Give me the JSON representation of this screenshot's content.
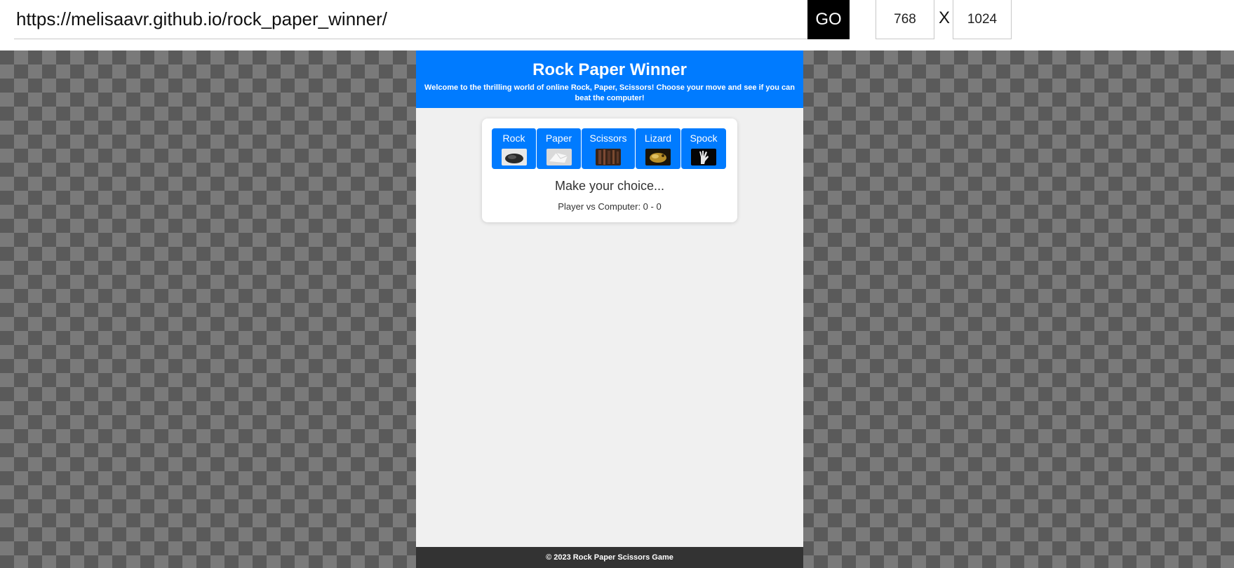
{
  "toolbar": {
    "url": "https://melisaavr.github.io/rock_paper_winner/",
    "go_label": "GO",
    "width_value": "768",
    "separator": "X",
    "height_value": "1024"
  },
  "header": {
    "title": "Rock Paper Winner",
    "subtitle": "Welcome to the thrilling world of online Rock, Paper, Scissors! Choose your move and see if you can beat the computer!"
  },
  "choices": [
    {
      "label": "Rock",
      "icon": "rock-photo"
    },
    {
      "label": "Paper",
      "icon": "paper-photo"
    },
    {
      "label": "Scissors",
      "icon": "scissors-photo"
    },
    {
      "label": "Lizard",
      "icon": "lizard-photo"
    },
    {
      "label": "Spock",
      "icon": "spock-hand-photo"
    }
  ],
  "game": {
    "result": "Make your choice...",
    "score": "Player vs Computer: 0 - 0"
  },
  "footer": {
    "text": "© 2023 Rock Paper Scissors Game"
  },
  "colors": {
    "primary": "#007bff",
    "footer_bg": "#333333",
    "page_bg": "#f0f0f0"
  }
}
